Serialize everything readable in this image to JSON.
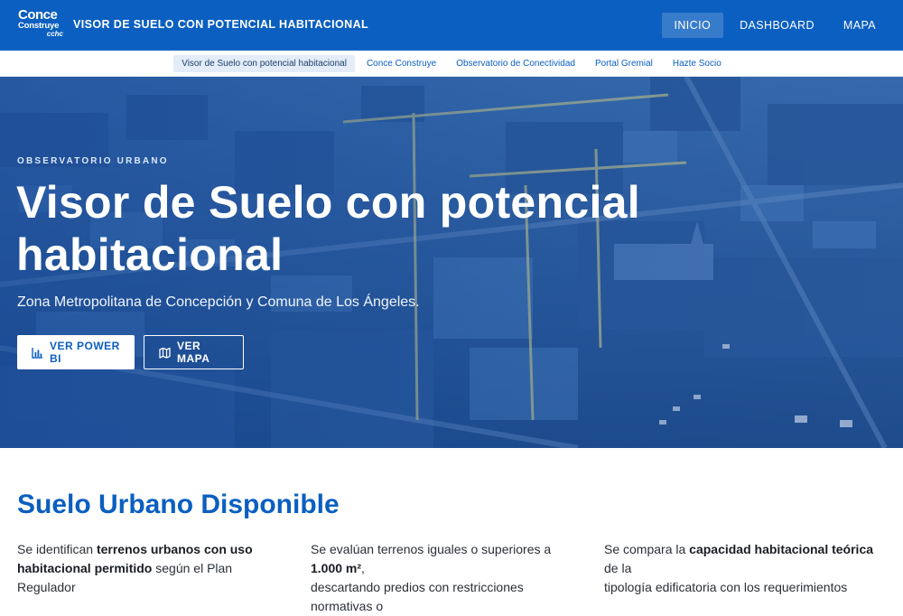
{
  "header": {
    "logo": {
      "line1": "Conce",
      "line2": "Construye",
      "line3": "cchc"
    },
    "title": "VISOR DE SUELO CON POTENCIAL HABITACIONAL",
    "nav": [
      {
        "label": "INICIO",
        "active": true
      },
      {
        "label": "DASHBOARD",
        "active": false
      },
      {
        "label": "MAPA",
        "active": false
      }
    ]
  },
  "subnav": [
    {
      "label": "Visor de Suelo con potencial habitacional",
      "active": true
    },
    {
      "label": "Conce Construye",
      "active": false
    },
    {
      "label": "Observatorio de Conectividad",
      "active": false
    },
    {
      "label": "Portal Gremial",
      "active": false
    },
    {
      "label": "Hazte Socio",
      "active": false
    }
  ],
  "hero": {
    "eyebrow": "OBSERVATORIO URBANO",
    "title": "Visor de Suelo con potencial habitacional",
    "subtitle": "Zona Metropolitana de Concepción y Comuna de Los Ángeles.",
    "buttons": {
      "powerbi": {
        "label": "VER POWER BI",
        "icon": "bar-chart-icon"
      },
      "map": {
        "label": "VER MAPA",
        "icon": "map-icon"
      }
    }
  },
  "section": {
    "title": "Suelo Urbano Disponible",
    "columns": [
      {
        "pre": "Se identifican ",
        "bold": "terrenos urbanos con uso",
        "post": "",
        "line2_bold": "habitacional permitido",
        "line2_post": " según el Plan Regulador"
      },
      {
        "pre": "Se evalúan terrenos iguales o superiores a ",
        "bold": "1.000 m²",
        "post": ",",
        "line2_bold": "",
        "line2_post": "descartando predios con restricciones normativas o"
      },
      {
        "pre": "Se compara la ",
        "bold": "capacidad habitacional teórica",
        "post": " de la",
        "line2_bold": "",
        "line2_post": "tipología edificatoria con los requerimientos"
      }
    ]
  },
  "colors": {
    "primary": "#0b5fc0",
    "white": "#ffffff"
  }
}
